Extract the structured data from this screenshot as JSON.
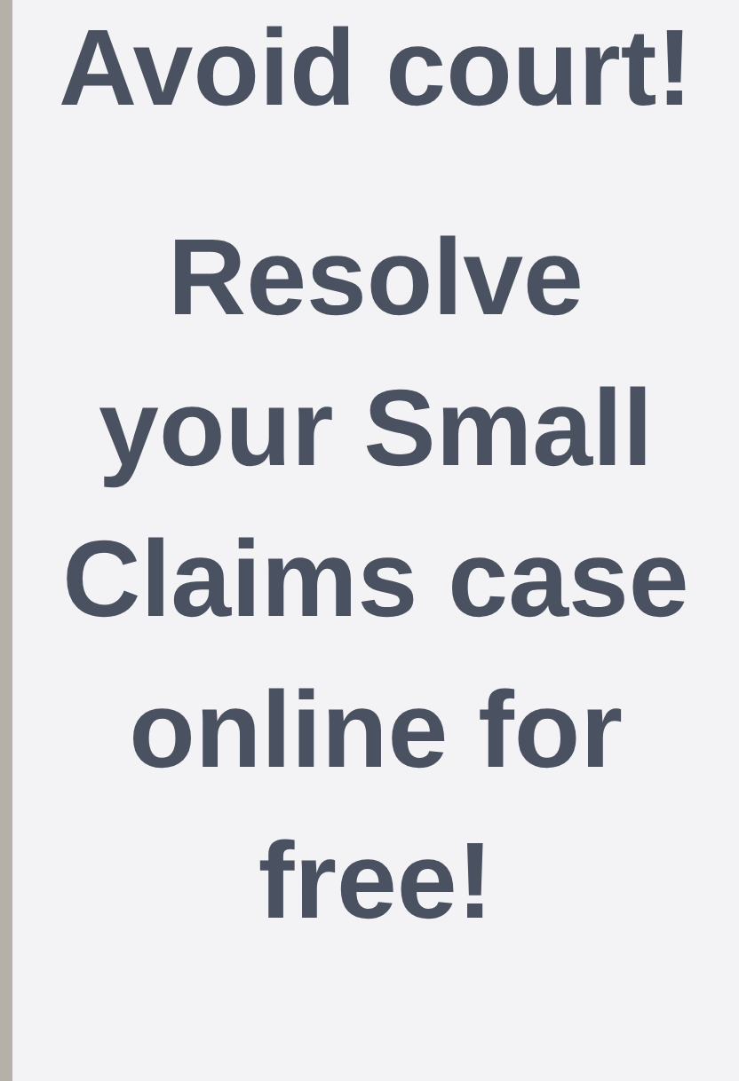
{
  "headline": "Avoid court!",
  "message": "Resolve your Small Claims case online for free!"
}
